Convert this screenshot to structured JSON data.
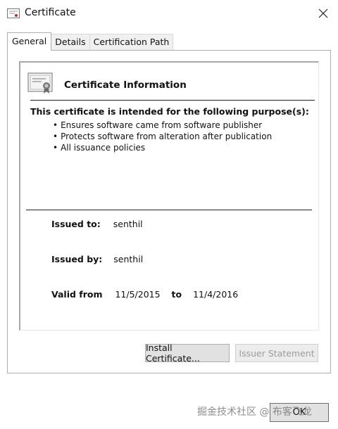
{
  "window": {
    "title": "Certificate",
    "close_glyph": "✕"
  },
  "tabs": [
    {
      "label": "General",
      "active": true
    },
    {
      "label": "Details",
      "active": false
    },
    {
      "label": "Certification Path",
      "active": false
    }
  ],
  "info": {
    "title": "Certificate Information",
    "purpose_heading": "This certificate is intended for the following purpose(s):",
    "purposes": [
      "Ensures software came from software publisher",
      "Protects software from alteration after publication",
      "All issuance policies"
    ],
    "issued_to_label": "Issued to:",
    "issued_to_value": "senthil",
    "issued_by_label": "Issued by:",
    "issued_by_value": "senthil",
    "valid_from_label": "Valid from",
    "valid_from_value": "11/5/2015",
    "valid_to_label": "to",
    "valid_to_value": "11/4/2016"
  },
  "buttons": {
    "install": "Install Certificate...",
    "issuer": "Issuer Statement",
    "ok": "OK"
  },
  "watermark": "掘金技术社区 @ 布客飞龙",
  "icons": {
    "title_icon": "certificate-small-icon",
    "cert_icon": "certificate-icon",
    "close_icon": "close-icon"
  }
}
